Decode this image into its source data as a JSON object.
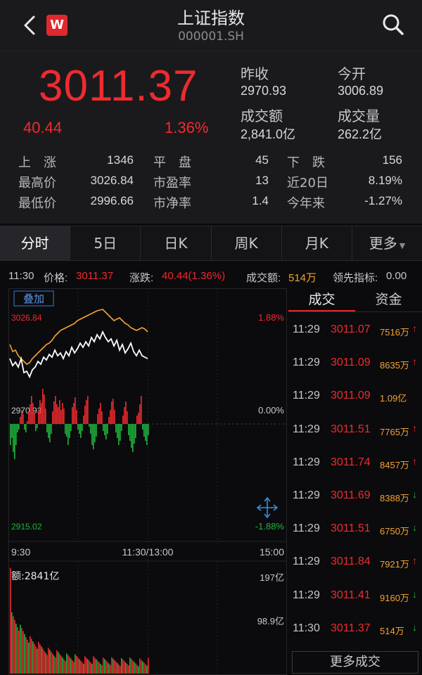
{
  "header": {
    "title": "上证指数",
    "code": "000001.SH",
    "logo": "W"
  },
  "quote": {
    "price": "3011.37",
    "change": "40.44",
    "change_pct": "1.36%",
    "prev_close_label": "昨收",
    "prev_close": "2970.93",
    "open_label": "今开",
    "open": "3006.89",
    "turnover_label": "成交额",
    "turnover": "2,841.0亿",
    "volume_label": "成交量",
    "volume": "262.2亿"
  },
  "stats": [
    {
      "label": "上　涨",
      "value": "1346"
    },
    {
      "label": "平　盘",
      "value": "45"
    },
    {
      "label": "下　跌",
      "value": "156"
    },
    {
      "label": "最高价",
      "value": "3026.84"
    },
    {
      "label": "市盈率",
      "value": "13"
    },
    {
      "label": "近20日",
      "value": "8.19%"
    },
    {
      "label": "最低价",
      "value": "2996.66"
    },
    {
      "label": "市净率",
      "value": "1.4"
    },
    {
      "label": "今年来",
      "value": "-1.27%"
    }
  ],
  "tabs": [
    "分时",
    "5日",
    "日K",
    "周K",
    "月K",
    "更多"
  ],
  "info": {
    "time": "11:30",
    "price_label": "价格:",
    "price": "3011.37",
    "change_label": "涨跌:",
    "change": "40.44(1.36%)",
    "turnover_label": "成交额:",
    "turnover": "514万",
    "leader_label": "领先指标:",
    "leader": "0.00"
  },
  "chart": {
    "overlay_button": "叠加",
    "high_price": "3026.84",
    "high_pct": "1.88%",
    "mid_price": "2970.93",
    "mid_pct": "0.00%",
    "low_price": "2915.02",
    "low_pct": "-1.88%",
    "time_start": "9:30",
    "time_mid": "11:30/13:00",
    "time_end": "15:00",
    "vol_label": "额:2841亿",
    "vol_max": "197亿",
    "vol_mid": "98.9亿",
    "colors": {
      "up": "#f02a2e",
      "down": "#1fb53d",
      "price_line": "#ffffff",
      "avg_line": "#f3a233"
    }
  },
  "right_panel": {
    "tab_trades": "成交",
    "tab_funds": "资金",
    "trades": [
      {
        "time": "11:29",
        "price": "3011.07",
        "vol": "7516万",
        "dir": "up"
      },
      {
        "time": "11:29",
        "price": "3011.09",
        "vol": "8635万",
        "dir": "up"
      },
      {
        "time": "11:29",
        "price": "3011.09",
        "vol": "1.09亿",
        "dir": "none"
      },
      {
        "time": "11:29",
        "price": "3011.51",
        "vol": "7765万",
        "dir": "up"
      },
      {
        "time": "11:29",
        "price": "3011.74",
        "vol": "8457万",
        "dir": "up"
      },
      {
        "time": "11:29",
        "price": "3011.69",
        "vol": "8388万",
        "dir": "down"
      },
      {
        "time": "11:29",
        "price": "3011.51",
        "vol": "6750万",
        "dir": "down"
      },
      {
        "time": "11:29",
        "price": "3011.84",
        "vol": "7921万",
        "dir": "up"
      },
      {
        "time": "11:29",
        "price": "3011.41",
        "vol": "9160万",
        "dir": "down"
      },
      {
        "time": "11:30",
        "price": "3011.37",
        "vol": "514万",
        "dir": "down"
      }
    ],
    "more_label": "更多成交"
  }
}
